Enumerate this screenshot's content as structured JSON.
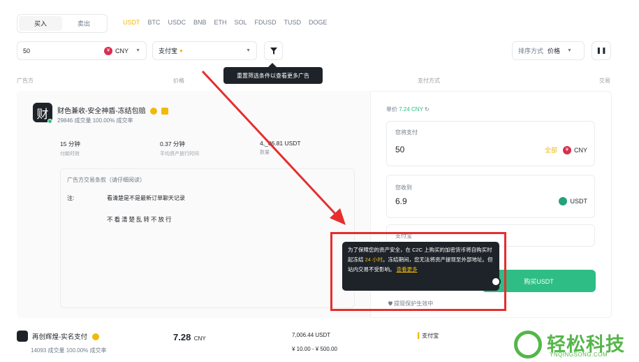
{
  "side_tabs": {
    "buy": "买入",
    "sell": "卖出"
  },
  "coins": [
    "USDT",
    "BTC",
    "USDC",
    "BNB",
    "ETH",
    "SOL",
    "FDUSD",
    "TUSD",
    "DOGE"
  ],
  "filters": {
    "amount": "50",
    "fiat_badge": "¥",
    "fiat": "CNY",
    "payment": "支付宝",
    "sort_label": "排序方式",
    "sort_value": "价格",
    "tooltip": "重置筛选条件以查看更多广告"
  },
  "columns": {
    "advertiser": "广告方",
    "price": "价格",
    "payment": "支付方式",
    "trade": "交易"
  },
  "merchant": {
    "avatar_char": "财",
    "name": "财色兼收-安全神盾-冻结包赔",
    "stats": "29846 成交量   100.00% 成交率",
    "metrics": [
      {
        "value": "15 分钟",
        "label": "付款时效"
      },
      {
        "value": "0.37 分钟",
        "label": "平均资产放行时间"
      },
      {
        "value": "4,_06.81 USDT",
        "label": "数量"
      }
    ],
    "terms_title": "广告方交易条款（请仔细阅读）",
    "terms_note": "注:",
    "terms_line1": "看清楚是不是最新订单聊天记录",
    "terms_line2": "不看清楚乱转不放行"
  },
  "order": {
    "unit_price_label": "单价",
    "unit_price": "7.24 CNY",
    "pay_label": "您将支付",
    "pay_value": "50",
    "all_label": "全部",
    "pay_currency": "CNY",
    "receive_label": "您收到",
    "receive_value": "6.9",
    "receive_currency": "USDT",
    "method_hint": "支付宝",
    "buy_button": "购买USDT",
    "protection": "提现保护生效中"
  },
  "popup": {
    "text1": "为了保障您的资产安全，在 C2C 上购买的加密货币将自购买时起冻结 ",
    "text_hl": "24 小时",
    "text2": "。冻结期间，您无法将资产提现至外部地址。",
    "text3": "但站内交易不受影响。",
    "link": "查看更多"
  },
  "merchant2": {
    "name": "再创辉煌-实名支付",
    "stats": "14093 成交量   100.00% 成交率",
    "price": "7.28",
    "price_unit": "CNY",
    "available": "7,006.44 USDT",
    "limit": "¥ 10.00 - ¥ 500.00",
    "payment": "支付宝"
  },
  "watermark": {
    "cn": "轻松科技",
    "en": "YNQINGSONG.COM"
  },
  "colors": {
    "accent": "#f0b90b",
    "buy": "#2ebd85",
    "highlight": "#e62e2e"
  }
}
